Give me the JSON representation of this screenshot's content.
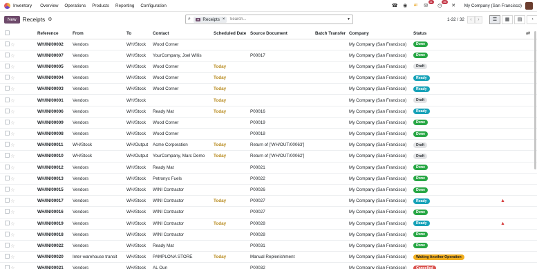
{
  "navbar": {
    "app_name": "Inventory",
    "menu": [
      "Overview",
      "Operations",
      "Products",
      "Reporting",
      "Configuration"
    ],
    "messages_count": "11",
    "activities_count": "36",
    "company": "My Company (San Francisco)"
  },
  "control": {
    "new_label": "New",
    "title": "Receipts",
    "facet_label": "Receipts",
    "search_placeholder": "Search...",
    "pager": "1-32 / 32"
  },
  "table": {
    "headers": [
      "Reference",
      "From",
      "To",
      "Contact",
      "Scheduled Date",
      "Source Document",
      "Batch Transfer",
      "Company",
      "Status"
    ],
    "rows": [
      {
        "ref": "WH/IN/00002",
        "from": "Vendors",
        "to": "WH/Stock",
        "contact": "Wood Corner",
        "date": "",
        "source": "",
        "batch": "",
        "company": "My Company (San Francisco)",
        "status": "Done",
        "status_class": "b-done",
        "warn": false
      },
      {
        "ref": "WH/IN/00007",
        "from": "Vendors",
        "to": "WH/Stock",
        "contact": "YourCompany, Joel Willis",
        "date": "",
        "source": "P00017",
        "batch": "",
        "company": "My Company (San Francisco)",
        "status": "Done",
        "status_class": "b-done",
        "warn": false
      },
      {
        "ref": "WH/IN/00005",
        "from": "Vendors",
        "to": "WH/Stock",
        "contact": "Wood Corner",
        "date": "Today",
        "source": "",
        "batch": "",
        "company": "My Company (San Francisco)",
        "status": "Draft",
        "status_class": "b-draft",
        "warn": false
      },
      {
        "ref": "WH/IN/00004",
        "from": "Vendors",
        "to": "WH/Stock",
        "contact": "Wood Corner",
        "date": "Today",
        "source": "",
        "batch": "",
        "company": "My Company (San Francisco)",
        "status": "Ready",
        "status_class": "b-ready",
        "warn": false
      },
      {
        "ref": "WH/IN/00003",
        "from": "Vendors",
        "to": "WH/Stock",
        "contact": "Wood Corner",
        "date": "Today",
        "source": "",
        "batch": "",
        "company": "My Company (San Francisco)",
        "status": "Ready",
        "status_class": "b-ready",
        "warn": false
      },
      {
        "ref": "WH/IN/00001",
        "from": "Vendors",
        "to": "WH/Stock",
        "contact": "",
        "date": "Today",
        "source": "",
        "batch": "",
        "company": "My Company (San Francisco)",
        "status": "Draft",
        "status_class": "b-draft",
        "warn": false
      },
      {
        "ref": "WH/IN/00006",
        "from": "Vendors",
        "to": "WH/Stock",
        "contact": "Ready Mat",
        "date": "Today",
        "source": "P00016",
        "batch": "",
        "company": "My Company (San Francisco)",
        "status": "Ready",
        "status_class": "b-ready",
        "warn": false
      },
      {
        "ref": "WH/IN/00009",
        "from": "Vendors",
        "to": "WH/Stock",
        "contact": "Wood Corner",
        "date": "",
        "source": "P00019",
        "batch": "",
        "company": "My Company (San Francisco)",
        "status": "Done",
        "status_class": "b-done",
        "warn": false
      },
      {
        "ref": "WH/IN/00008",
        "from": "Vendors",
        "to": "WH/Stock",
        "contact": "Wood Corner",
        "date": "",
        "source": "P00018",
        "batch": "",
        "company": "My Company (San Francisco)",
        "status": "Done",
        "status_class": "b-done",
        "warn": false
      },
      {
        "ref": "WH/IN/00011",
        "from": "WH/Stock",
        "to": "WH/Output",
        "contact": "Acme Corporation",
        "date": "Today",
        "source": "Return of ['WH/OUT/00063']",
        "batch": "",
        "company": "My Company (San Francisco)",
        "status": "Draft",
        "status_class": "b-draft",
        "warn": false
      },
      {
        "ref": "WH/IN/00010",
        "from": "WH/Stock",
        "to": "WH/Output",
        "contact": "YourCompany, Marc Demo",
        "date": "Today",
        "source": "Return of ['WH/OUT/00062']",
        "batch": "",
        "company": "My Company (San Francisco)",
        "status": "Draft",
        "status_class": "b-draft",
        "warn": false
      },
      {
        "ref": "WH/IN/00012",
        "from": "Vendors",
        "to": "WH/Stock",
        "contact": "Ready Mat",
        "date": "",
        "source": "P00021",
        "batch": "",
        "company": "My Company (San Francisco)",
        "status": "Done",
        "status_class": "b-done",
        "warn": false
      },
      {
        "ref": "WH/IN/00013",
        "from": "Vendors",
        "to": "WH/Stock",
        "contact": "Petronyx Fuels",
        "date": "",
        "source": "P00022",
        "batch": "",
        "company": "My Company (San Francisco)",
        "status": "Done",
        "status_class": "b-done",
        "warn": false
      },
      {
        "ref": "WH/IN/00015",
        "from": "Vendors",
        "to": "WH/Stock",
        "contact": "WINI Contractor",
        "date": "",
        "source": "P00026",
        "batch": "",
        "company": "My Company (San Francisco)",
        "status": "Done",
        "status_class": "b-done",
        "warn": false
      },
      {
        "ref": "WH/IN/00017",
        "from": "Vendors",
        "to": "WH/Stock",
        "contact": "WINI Contractor",
        "date": "Today",
        "source": "P00027",
        "batch": "",
        "company": "My Company (San Francisco)",
        "status": "Ready",
        "status_class": "b-ready",
        "warn": true
      },
      {
        "ref": "WH/IN/00016",
        "from": "Vendors",
        "to": "WH/Stock",
        "contact": "WINI Contractor",
        "date": "",
        "source": "P00027",
        "batch": "",
        "company": "My Company (San Francisco)",
        "status": "Done",
        "status_class": "b-done",
        "warn": false
      },
      {
        "ref": "WH/IN/00019",
        "from": "Vendors",
        "to": "WH/Stock",
        "contact": "WINI Contractor",
        "date": "Today",
        "source": "P00028",
        "batch": "",
        "company": "My Company (San Francisco)",
        "status": "Ready",
        "status_class": "b-ready",
        "warn": true
      },
      {
        "ref": "WH/IN/00018",
        "from": "Vendors",
        "to": "WH/Stock",
        "contact": "WINI Contractor",
        "date": "",
        "source": "P00028",
        "batch": "",
        "company": "My Company (San Francisco)",
        "status": "Done",
        "status_class": "b-done",
        "warn": false
      },
      {
        "ref": "WH/IN/00022",
        "from": "Vendors",
        "to": "WH/Stock",
        "contact": "Ready Mat",
        "date": "",
        "source": "P00031",
        "batch": "",
        "company": "My Company (San Francisco)",
        "status": "Done",
        "status_class": "b-done",
        "warn": false
      },
      {
        "ref": "WH/IN/00020",
        "from": "Inter-warehouse transit",
        "to": "WH/Stock",
        "contact": "PAMPLONA STORE",
        "date": "Today",
        "source": "Manual Replenishment",
        "batch": "",
        "company": "My Company (San Francisco)",
        "status": "Waiting Another Operation",
        "status_class": "b-waiting",
        "warn": false
      },
      {
        "ref": "WH/IN/00021",
        "from": "Vendors",
        "to": "WH/Stock",
        "contact": "AL Oun",
        "date": "",
        "source": "P00032",
        "batch": "",
        "company": "My Company (San Francisco)",
        "status": "Cancelled",
        "status_class": "b-cancel",
        "warn": false
      }
    ]
  }
}
